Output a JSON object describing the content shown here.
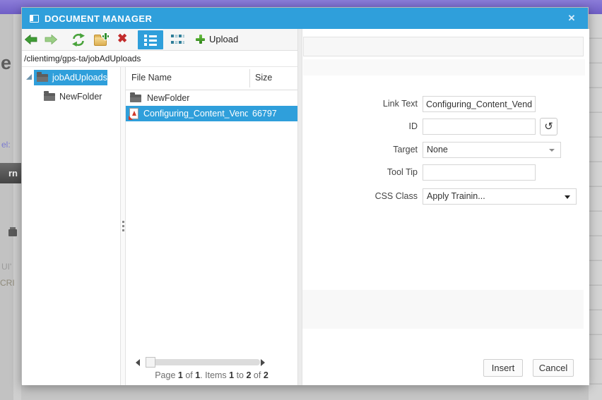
{
  "chrome": {
    "title": "DOCUMENT MANAGER",
    "close": "✕"
  },
  "toolbar": {
    "back": "back",
    "forward": "forward",
    "refresh": "refresh",
    "new_folder": "new folder",
    "delete": "✖",
    "upload": "Upload"
  },
  "pathbar": {
    "path": "/clientimg/gps-ta/jobAdUploads"
  },
  "tree": {
    "root": "jobAdUploads",
    "child": "NewFolder"
  },
  "list": {
    "col_name": "File Name",
    "col_size": "Size",
    "rows": [
      {
        "name": "NewFolder",
        "size": "",
        "type": "folder",
        "selected": false
      },
      {
        "name": "Configuring_Content_Vendo",
        "size": "66797",
        "type": "pdf",
        "selected": true
      }
    ]
  },
  "pager": {
    "s1": "Page ",
    "n1": "1",
    "s2": " of ",
    "n2": "1",
    "s3": ". Items ",
    "n3": "1",
    "s4": " to ",
    "n4": "2",
    "s5": " of ",
    "n5": "2"
  },
  "form": {
    "link_text": {
      "label": "Link Text",
      "value": "Configuring_Content_Vendor"
    },
    "id": {
      "label": "ID",
      "value": "",
      "refresh_icon": "↺"
    },
    "target": {
      "label": "Target",
      "value": "None"
    },
    "tooltip": {
      "label": "Tool Tip",
      "value": ""
    },
    "css_class": {
      "label": "CSS Class",
      "value": "Apply Trainin..."
    }
  },
  "footer": {
    "insert": "Insert",
    "cancel": "Cancel"
  },
  "background": {
    "frag_e": "e",
    "frag_el": "el:",
    "frag_rn": "rn",
    "frag_ui": "UI'",
    "frag_cri": "CRI"
  },
  "colors": {
    "accent": "#2f9fdb",
    "purple": "#7d6dcb",
    "green": "#3f9c35",
    "red": "#c22b2b",
    "folder_yellow": "#e0b455",
    "dim_bg": "#c6c6c6"
  }
}
